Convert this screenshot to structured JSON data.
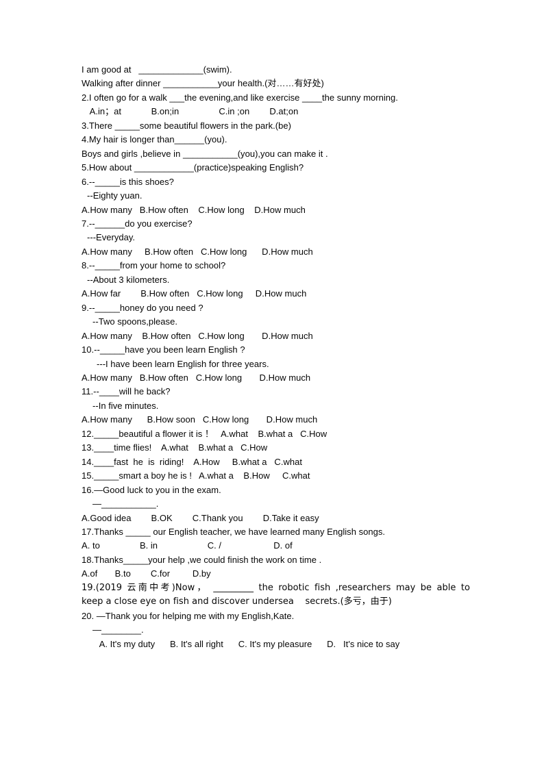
{
  "document": {
    "type": "english-grammar-worksheet",
    "lines": [
      {
        "id": "l1",
        "indent": 0,
        "text": "I am good at   _____________(swim)."
      },
      {
        "id": "l2",
        "indent": 0,
        "text": "Walking after dinner ___________your health.(对……有好处)"
      },
      {
        "id": "l3",
        "indent": 0,
        "text": "2.I often go for a walk ___the evening,and like exercise ____the sunny morning."
      },
      {
        "id": "l4",
        "indent": 1,
        "text": " A.in；at            B.on;in                C.in ;on        D.at;on"
      },
      {
        "id": "l5",
        "indent": 0,
        "text": "3.There _____some beautiful flowers in the park.(be)"
      },
      {
        "id": "l6",
        "indent": 0,
        "text": "4.My hair is longer than______(you)."
      },
      {
        "id": "l7",
        "indent": 0,
        "text": "Boys and girls ,believe in ___________(you),you can make it ."
      },
      {
        "id": "l8",
        "indent": 0,
        "text": "5.How about ____________(practice)speaking English?"
      },
      {
        "id": "l9",
        "indent": 0,
        "text": "6.--_____is this shoes?"
      },
      {
        "id": "l10",
        "indent": 1,
        "text": "--Eighty yuan."
      },
      {
        "id": "l11",
        "indent": 0,
        "text": "A.How many   B.How often    C.How long    D.How much"
      },
      {
        "id": "l12",
        "indent": 0,
        "text": "7.--______do you exercise?"
      },
      {
        "id": "l13",
        "indent": 1,
        "text": "---Everyday."
      },
      {
        "id": "l14",
        "indent": 0,
        "text": "A.How many     B.How often   C.How long      D.How much"
      },
      {
        "id": "l15",
        "indent": 0,
        "text": "8.--_____from your home to school?"
      },
      {
        "id": "l16",
        "indent": 1,
        "text": "--About 3 kilometers."
      },
      {
        "id": "l17",
        "indent": 0,
        "text": "A.How far        B.How often   C.How long     D.How much"
      },
      {
        "id": "l18",
        "indent": 0,
        "text": "9.--_____honey do you need ?"
      },
      {
        "id": "l19",
        "indent": 2,
        "text": "--Two spoons,please."
      },
      {
        "id": "l20",
        "indent": 0,
        "text": "A.How many    B.How often   C.How long       D.How much"
      },
      {
        "id": "l21",
        "indent": 0,
        "text": "10.--_____have you been learn English ?"
      },
      {
        "id": "l22",
        "indent": 3,
        "text": "---I have been learn English for three years."
      },
      {
        "id": "l23",
        "indent": 0,
        "text": "A.How many   B.How often   C.How long       D.How much"
      },
      {
        "id": "l24",
        "indent": 0,
        "text": "11.--____will he back?"
      },
      {
        "id": "l25",
        "indent": 2,
        "text": "--In five minutes."
      },
      {
        "id": "l26",
        "indent": 0,
        "text": "A.How many      B.How soon   C.How long       D.How much"
      },
      {
        "id": "l27",
        "indent": 0,
        "text": "12._____beautiful a flower it is ！   A.what    B.what a   C.How"
      },
      {
        "id": "l28",
        "indent": 0,
        "text": "13.____time flies!    A.what    B.what a   C.How"
      },
      {
        "id": "l29",
        "indent": 0,
        "text": "14.____fast  he  is  riding!    A.How     B.what a   C.what"
      },
      {
        "id": "l30",
        "indent": 0,
        "text": "15._____smart a boy he is !   A.what a    B.How     C.what"
      },
      {
        "id": "l31",
        "indent": 0,
        "text": "16.—Good luck to you in the exam."
      },
      {
        "id": "l32",
        "indent": 2,
        "text": "—___________."
      },
      {
        "id": "l33",
        "indent": 0,
        "text": "A.Good idea        B.OK        C.Thank you        D.Take it easy"
      },
      {
        "id": "l34",
        "indent": 0,
        "text": "17.Thanks _____ our English teacher, we have learned many English songs."
      },
      {
        "id": "l35",
        "indent": 0,
        "text": "A. to                B. in                    C. /                     D. of"
      },
      {
        "id": "l36",
        "indent": 0,
        "text": "18.Thanks_____your help ,we could finish the work on time ."
      },
      {
        "id": "l37",
        "indent": 0,
        "text": "A.of       B.to        C.for         D.by"
      },
      {
        "id": "l40",
        "indent": 0,
        "text": "20. —Thank you for helping me with my English,Kate."
      },
      {
        "id": "l41",
        "indent": 2,
        "text": "—________."
      },
      {
        "id": "l42",
        "indent": 3,
        "text": " A. It's my duty      B. It's all right      C. It's my pleasure      D.   It's nice to say"
      }
    ],
    "question19": {
      "line_a": "19.(2019 云南中考)Now， _________ the robotic fish ,researchers may be able to",
      "line_b": "keep a close eye on fish and discover undersea    secrets.(多亏，由于)"
    }
  }
}
